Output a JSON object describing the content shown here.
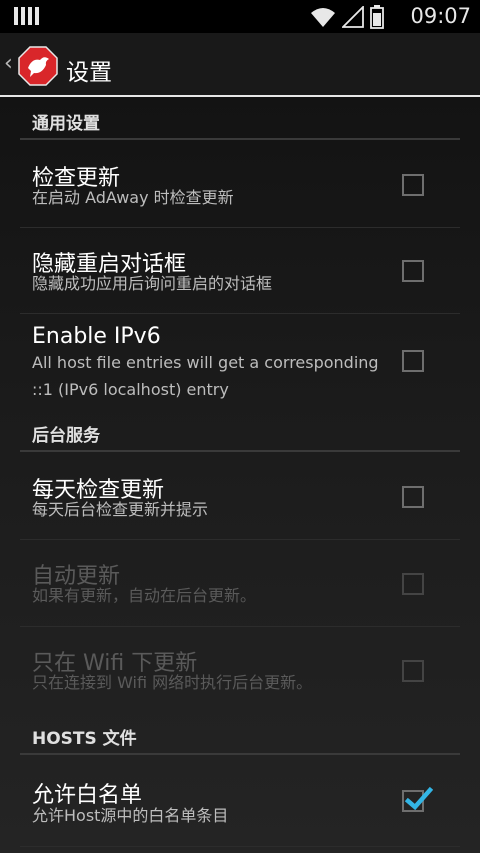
{
  "status_bar": {
    "time": "09:07"
  },
  "action_bar": {
    "title": "设置"
  },
  "sections": {
    "general": "通用设置",
    "background": "后台服务",
    "hosts": "HOSTS 文件"
  },
  "items": {
    "check_update": {
      "title": "检查更新",
      "summary": "在启动 AdAway 时检查更新",
      "checked": false
    },
    "hide_reboot": {
      "title": "隐藏重启对话框",
      "summary": "隐藏成功应用后询问重启的对话框",
      "checked": false
    },
    "ipv6": {
      "title": "Enable IPv6",
      "summary": "All host file entries will get a corresponding ::1 (IPv6 localhost) entry",
      "checked": false
    },
    "daily_check": {
      "title": "每天检查更新",
      "summary": "每天后台检查更新并提示",
      "checked": false
    },
    "auto_update": {
      "title": "自动更新",
      "summary": "如果有更新，自动在后台更新。",
      "checked": false,
      "enabled": false
    },
    "wifi_only": {
      "title": "只在 Wifi 下更新",
      "summary": "只在连接到 Wifi 网络时执行后台更新。",
      "checked": false,
      "enabled": false
    },
    "whitelist": {
      "title": "允许白名单",
      "summary": "允许Host源中的白名单条目",
      "checked": true
    }
  },
  "colors": {
    "accent": "#33b5e5",
    "logo_red": "#d9262a"
  }
}
